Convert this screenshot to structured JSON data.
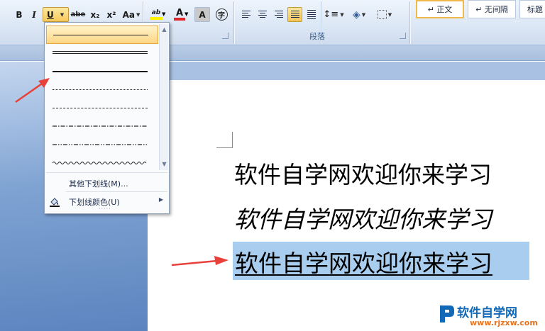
{
  "ribbon": {
    "font_group": {
      "bold": "B",
      "italic": "I",
      "underline": "U",
      "strikethrough": "abe",
      "subscript": "x₂",
      "superscript": "x²",
      "change_case": "Aa",
      "highlight": "ab",
      "font_color": "A",
      "char_shading": "A",
      "enclose_char": "字"
    },
    "paragraph_group": {
      "label": "段落"
    },
    "styles": [
      {
        "label": "↵ 正文",
        "selected": true
      },
      {
        "label": "↵ 无间隔",
        "selected": false
      },
      {
        "label": "标题",
        "selected": false
      }
    ]
  },
  "underline_dropdown": {
    "styles": [
      "single-thick",
      "double",
      "thick",
      "dotted",
      "dashed",
      "dash-dot",
      "dash-dot-dot",
      "wave"
    ],
    "more_underlines": "其他下划线(M)...",
    "underline_color": "下划线颜色(U)"
  },
  "document": {
    "lines": [
      {
        "text": "软件自学网欢迎你来学习",
        "style": "normal"
      },
      {
        "text": "软件自学网欢迎你来学习",
        "style": "italic"
      },
      {
        "text": "软件自学网欢迎你来学习",
        "style": "underline-selected"
      }
    ]
  },
  "watermark": {
    "title": "软件自学网",
    "url": "www.rjzxw.com"
  },
  "colors": {
    "selection": "#a9cdee",
    "annotation_arrow": "#e8413a",
    "hover_item": "#ffd685",
    "font_color_bar": "#e0262a",
    "highlight_bar": "#fff200"
  }
}
